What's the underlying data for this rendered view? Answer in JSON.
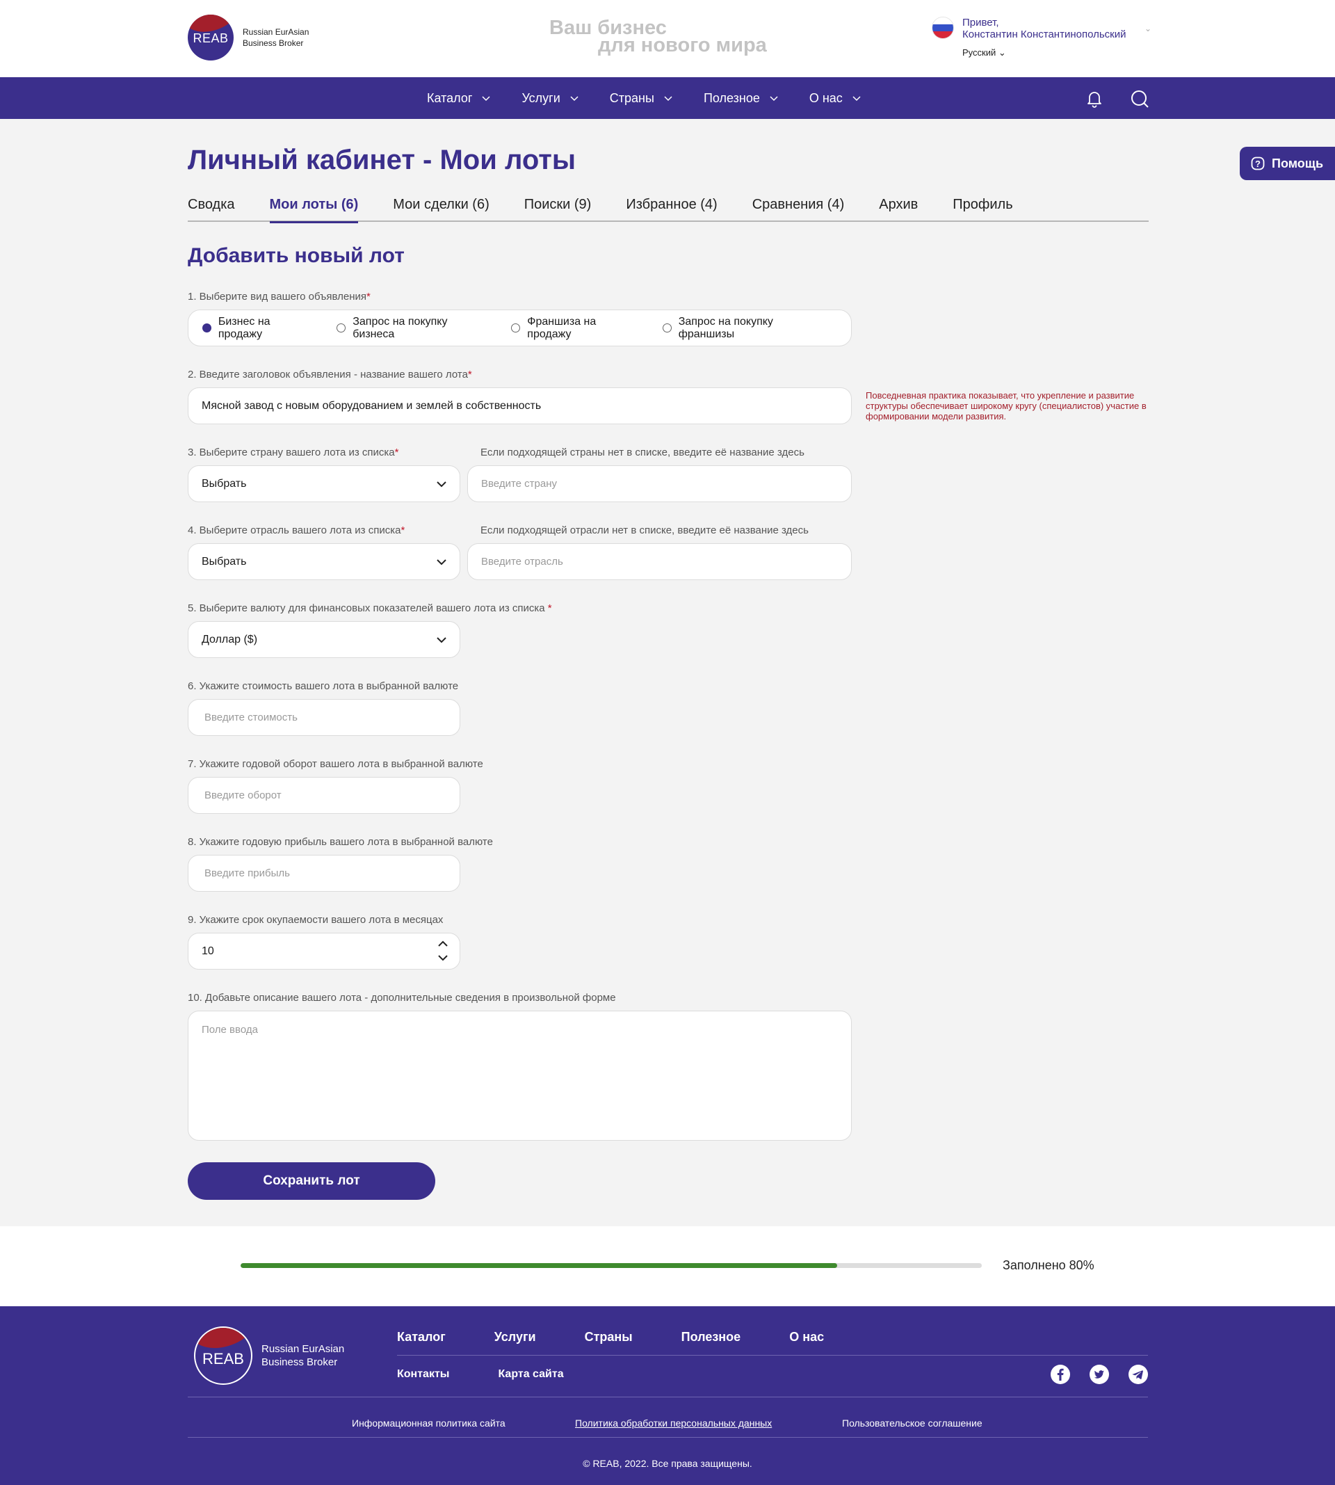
{
  "header": {
    "logo_abbr": "REAB",
    "logo_line1": "Russian EurAsian",
    "logo_line2": "Business Broker",
    "slogan_line1": "Ваш бизнес",
    "slogan_line2": "для нового мира",
    "greeting": "Привет,",
    "user_name": "Константин Константинопольский",
    "language": "Русский"
  },
  "nav": {
    "items": [
      {
        "label": "Каталог"
      },
      {
        "label": "Услуги"
      },
      {
        "label": "Страны"
      },
      {
        "label": "Полезное"
      },
      {
        "label": "О нас"
      }
    ],
    "icons": [
      "bell-icon",
      "search-icon"
    ]
  },
  "help_label": "Помощь",
  "page_title": "Личный кабинет - Мои лоты",
  "tabs": [
    {
      "label": "Сводка"
    },
    {
      "label": "Мои лоты (6)",
      "active": true
    },
    {
      "label": "Мои сделки (6)"
    },
    {
      "label": "Поиски (9)"
    },
    {
      "label": "Избранное (4)"
    },
    {
      "label": "Сравнения (4)"
    },
    {
      "label": "Архив"
    },
    {
      "label": "Профиль"
    }
  ],
  "form": {
    "title": "Добавить новый лот",
    "q1": {
      "label": "1. Выберите вид вашего объявления",
      "options": [
        "Бизнес на продажу",
        "Запрос на покупку бизнеса",
        "Франшиза на продажу",
        "Запрос на покупку франшизы"
      ],
      "selected": "Бизнес на продажу"
    },
    "q2": {
      "label": "2. Введите заголовок объявления - название вашего лота",
      "value": "Мясной завод с новым оборудованием и землей в собственность",
      "hint": "Повседневная практика показывает, что укрепление и развитие структуры обеспечивает широкому кругу (специалистов) участие в формировании модели развития."
    },
    "q3": {
      "label": "3. Выберите страну вашего лота из списка",
      "select_value": "Выбрать",
      "alt_label": "Если подходящей страны нет в списке, введите её название здесь",
      "alt_placeholder": "Введите страну"
    },
    "q4": {
      "label": "4. Выберите отрасль вашего лота из списка",
      "select_value": "Выбрать",
      "alt_label": "Если подходящей отрасли нет в списке, введите её название здесь",
      "alt_placeholder": "Введите отрасль"
    },
    "q5": {
      "label": "5. Выберите валюту для финансовых показателей вашего лота из списка ",
      "select_value": "Доллар ($)"
    },
    "q6": {
      "label": "6. Укажите стоимость вашего лота в выбранной валюте",
      "placeholder": "Введите стоимость"
    },
    "q7": {
      "label": "7. Укажите годовой оборот вашего лота в выбранной валюте",
      "placeholder": "Введите оборот"
    },
    "q8": {
      "label": "8. Укажите годовую прибыль вашего лота в выбранной валюте",
      "placeholder": "Введите прибыль"
    },
    "q9": {
      "label": "9. Укажите срок окупаемости вашего лота в месяцах",
      "value": "10"
    },
    "q10": {
      "label": "10. Добавьте описание вашего лота - дополнительные сведения в произвольной форме",
      "placeholder": "Поле ввода"
    },
    "required_mark": "*",
    "save_label": "Сохранить лот"
  },
  "progress": {
    "fraction": 0.805,
    "label": "Заполнено 80%"
  },
  "footer": {
    "logo_abbr": "REAB",
    "logo_line1": "Russian EurAsian",
    "logo_line2": "Business Broker",
    "menu": [
      "Каталог",
      "Услуги",
      "Страны",
      "Полезное",
      "О нас"
    ],
    "sub": [
      "Контакты",
      "Карта сайта"
    ],
    "social_icons": [
      "facebook-icon",
      "twitter-icon",
      "telegram-icon"
    ],
    "links": [
      "Информационная политика сайта",
      "Политика обработки персональных данных",
      "Пользовательское соглашение"
    ],
    "copyright": "© REAB, 2022. Все права защищены."
  },
  "colors": {
    "brand": "#3b2f8c",
    "accent_red": "#a31f2b",
    "progress": "#3f8a2e",
    "background": "#f3f3f3"
  }
}
